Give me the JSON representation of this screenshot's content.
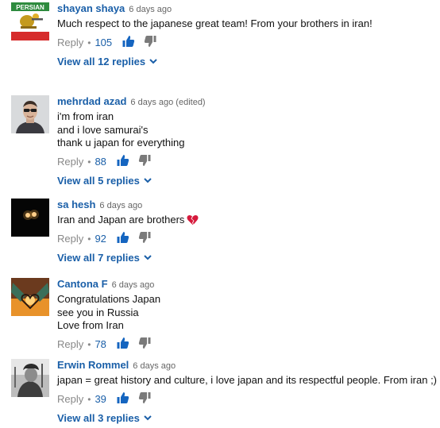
{
  "comments": [
    {
      "author": "shayan shaya",
      "time": "6 days ago",
      "lines": [
        "Much respect to the japanese great team! From your brothers in iran!"
      ],
      "reply_label": "Reply",
      "likes": "105",
      "view_replies": "View all 12 replies",
      "avatar_text": "PERSIAN"
    },
    {
      "author": "mehrdad azad",
      "time": "6 days ago (edited)",
      "lines": [
        "i'm from iran",
        "and i love samurai's",
        "thank u japan for everything"
      ],
      "reply_label": "Reply",
      "likes": "88",
      "view_replies": "View all 5 replies"
    },
    {
      "author": "sa hesh",
      "time": "6 days ago",
      "lines": [
        "Iran and Japan are brothers"
      ],
      "reply_label": "Reply",
      "likes": "92",
      "view_replies": "View all 7 replies"
    },
    {
      "author": "Cantona F",
      "time": "6 days ago",
      "lines": [
        "Congratulations Japan",
        "see you in Russia",
        "Love from Iran"
      ],
      "reply_label": "Reply",
      "likes": "78"
    },
    {
      "author": "Erwin Rommel",
      "time": "6 days ago",
      "lines": [
        "japan = great history and culture,  i love japan and its respectful people. From iran ;)"
      ],
      "reply_label": "Reply",
      "likes": "39",
      "view_replies": "View all 3 replies"
    }
  ],
  "colors": {
    "link": "#1a5fa8",
    "muted": "#888888",
    "thumb": "#1565c0",
    "dislike": "#7a7a7a",
    "heart": "#d61a3c"
  },
  "icons": [
    "thumbs-up-icon",
    "thumbs-down-icon",
    "chevron-down-icon",
    "broken-heart-icon"
  ]
}
